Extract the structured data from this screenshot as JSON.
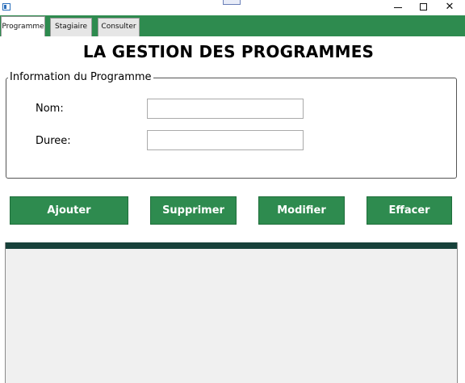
{
  "window": {
    "app_icon": "window-app-icon",
    "controls": {
      "minimize_icon": "minimize-icon",
      "maximize_icon": "maximize-icon",
      "close_glyph": "✕"
    }
  },
  "tabs": [
    {
      "label": "Programme",
      "active": true
    },
    {
      "label": "Stagiaire",
      "active": false
    },
    {
      "label": "Consulter",
      "active": false
    }
  ],
  "page": {
    "title": "LA GESTION DES PROGRAMMES"
  },
  "form": {
    "group_title": "Information du Programme",
    "nom_label": "Nom:",
    "nom_value": "",
    "duree_label": "Duree:",
    "duree_value": ""
  },
  "actions": {
    "ajouter": "Ajouter",
    "supprimer": "Supprimer",
    "modifier": "Modifier",
    "effacer": "Effacer"
  },
  "grid": {
    "columns": [],
    "rows": []
  },
  "colors": {
    "accent_green": "#2e8b4f",
    "grid_header": "#17413a",
    "grid_background": "#f0f0f0"
  }
}
